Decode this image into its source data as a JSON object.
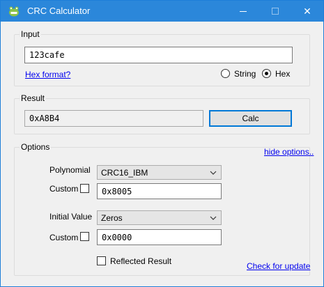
{
  "window": {
    "title": "CRC Calculator",
    "controls": {
      "minimize_icon": "minimize-icon",
      "maximize_icon": "maximize-icon",
      "close_icon": "close-icon",
      "close_glyph": "✕"
    }
  },
  "input": {
    "group_label": "Input",
    "value": "123cafe",
    "hex_format_link": "Hex format?",
    "radio_string_label": "String",
    "radio_hex_label": "Hex",
    "selected": "Hex"
  },
  "result": {
    "group_label": "Result",
    "value": "0xA8B4",
    "calc_button": "Calc"
  },
  "options": {
    "group_label": "Options",
    "hide_options_link": "hide options..",
    "polynomial_label": "Polynomial",
    "polynomial_selected": "CRC16_IBM",
    "polynomial_custom_label": "Custom",
    "polynomial_custom_value": "0x8005",
    "initial_value_label": "Initial Value",
    "initial_value_selected": "Zeros",
    "initial_custom_label": "Custom",
    "initial_custom_value": "0x0000",
    "reflected_label": "Reflected Result",
    "check_update_link": "Check for update"
  },
  "colors": {
    "titlebar": "#2b87da",
    "accent_border": "#0078d7",
    "link": "#0000ee"
  }
}
